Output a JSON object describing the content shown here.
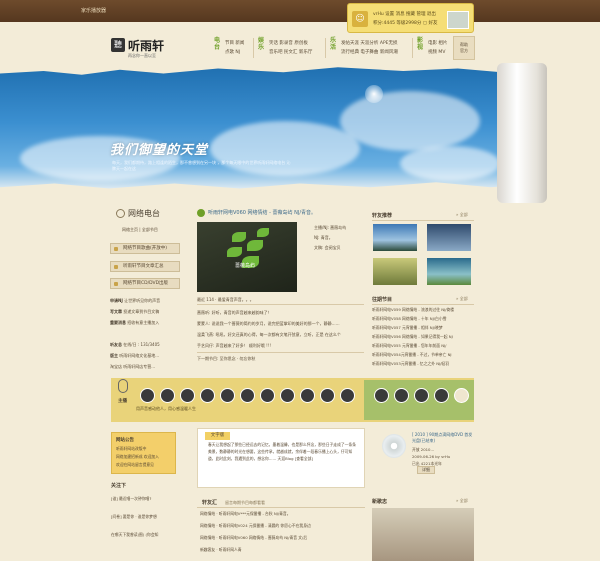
{
  "topbar": {
    "brand": "家乐播放器"
  },
  "userbox": {
    "line1": "vrHu  设置 消息 搜藏 管理 退出",
    "line2": "积分:4445 等级2998分 ▢ 好友"
  },
  "logo": {
    "name": "听雨轩",
    "slogan": "再念你一直以至",
    "mark": "聽"
  },
  "nav": [
    {
      "category": "电台",
      "links": [
        "节目 新闻",
        "点歌 NJ"
      ]
    },
    {
      "category": "娱乐",
      "links": [
        "笑话 影录音 原创板",
        "音乐吧 民文汇 新乐厅"
      ]
    },
    {
      "category": "乐活",
      "links": [
        "发帖天涯 天涯分析 APE无损",
        "流行经典 电子舞曲 新闻风潮"
      ]
    },
    {
      "category": "影视",
      "links": [
        "电影 相片",
        "视频 MV"
      ]
    }
  ],
  "nav_box": "帮助\n官方",
  "banner": {
    "title": "我们御望的天堂",
    "subtitle": "每天，我们都期待，路上相逢的陌生，那不曾想到在另一块 ，那个每天眼中的世界听雨轩网络电台 沁脾天一起在这"
  },
  "radio": {
    "title": "网络电台",
    "subtitle": "网络主页 | 全部节目",
    "buttons": [
      "网络节目歌曲(开放中)",
      "听雨轩节目文章汇总",
      "网络节目CD/DVD出版"
    ],
    "info": [
      {
        "k": "申请NJ",
        "v": "让世界听见你的声音"
      },
      {
        "k": "写文章",
        "v": "投递文章到节目文稿"
      },
      {
        "k": "重要消息",
        "v": "招收有意主播加入"
      }
    ],
    "stats": [
      {
        "k": "听友总",
        "v": "在线/日 : 131/3405"
      },
      {
        "k": "版主",
        "v": "听雨轩网络文化基地..."
      }
    ],
    "footer": "淘宝店  听雨轩网店专营..."
  },
  "program": {
    "heading": "听雨轩网电V060 网络情结 - 蔷薇岛屿 NJ/青音。",
    "photo_caption": "蔷薇岛屿",
    "meta": [
      "主播/NJ: 蔷薇岛屿",
      "NJ: 青音。",
      "文稿: 会阅宝贝"
    ],
    "rating": "最近 114 · 最爱青音声音。。。",
    "comments": [
      "蔷薇听: 好听，青音的声音越来越韵味了！",
      "蒙蒙人: 说说我一个蔷薇的简约的岁月，说完把蓝掌印的美好的那一个，静静……",
      "温柔飞燕: 吼吼，好文还真的心得，每一次都有文笔开弦意，立听，正是 在这么个",
      "手艺风仔: 声音越来了好多！ 顺利好哦 !!! "
    ],
    "nav": "下一期节目: 至你思念 · 勿忘你秋"
  },
  "right": {
    "recommend_title": "轩友推荐",
    "recommend_more": "» 全部",
    "history_title": "往期节目",
    "history_more": "» 全部",
    "history": [
      "听雨轩网电V059 网络情结 - 流浪的过往 NJ/倚楼",
      "听雨轩网电V058 网络情结 - 十年 NJ/白小雪",
      "听雨轩网电V057 元宵番播 - 相伴 NJ/晓梦",
      "听雨轩网电V056 网络情结 - 如果记得我一起 NJ",
      "听雨轩网电V055 元宵番播 - 您年年前面 NJ/",
      "听雨轩网电V054元宵番播 - 不过，节单亲亡 NJ",
      "听雨轩网电V053元宵番播 - 忆之之外 NJ/轻羽"
    ]
  },
  "band": {
    "label": "主播",
    "sub": "用声音感动他人，用心感温暖人生"
  },
  "notice": {
    "title": "网站公告",
    "items": [
      "听雨轩网站改版中",
      "网络加建招新成 欢迎加入",
      "欢迎在网站留言提意见"
    ]
  },
  "follow": {
    "title": "关注下",
    "items": [
      "[谁] 最近唱一次钟你唱?",
      "[问卷] 要是你 · 谁是你梦想",
      "在哪天下我曾读(图) (你会知"
    ]
  },
  "essay": {
    "tab": "文字版",
    "text": "春天让我想起了那些已经远去的记忆，墨着温馨，也是那么怀念，那些日子走成了一条条美景，数静静的时光在想要，这些传承，就越成就，余伴着一段春乐播上心头，仔可知道，此时此刻，我遇到此的，想念你…… 天涯Blog [查看全部]",
    "sub": "轩友汇",
    "sub_more": "留言每期节目每都看看",
    "rows": [
      "网络情结 · 听雨轩网电V***元保番播 - 台秋 NJ/青音。",
      "网络情结 · 听雨轩网电V024 元保番播 - 清晨的 你愿心不在我身边",
      "网络情结 · 听雨轩网电V060 网络情结 - 蔷薇岛屿 NJ/青音 文/后",
      "新趣客友 · 听雨轩网人青"
    ]
  },
  "cd": {
    "title": "[ 2010 ] 90期点滴网络DVD 首发光盘(已结束)",
    "meta": [
      "开放 2010...",
      "2009-06-26 by vrHu",
      "已出 4221本光年"
    ],
    "button": "详细"
  },
  "news": {
    "title": "新歌志",
    "more": "» 全部"
  }
}
